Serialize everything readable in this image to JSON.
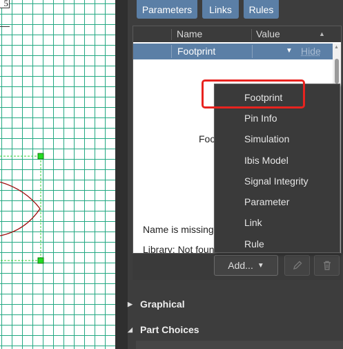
{
  "canvas": {
    "sheet_label": "5"
  },
  "panel": {
    "tabs": [
      "Parameters",
      "Links",
      "Rules"
    ],
    "table": {
      "columns": [
        "Name",
        "Value"
      ],
      "selected_row": {
        "name": "Footprint",
        "value_action": "Hide"
      },
      "message_partial": "Foo",
      "name_missing": "Name is missing",
      "library_partial": "Library: Not foun"
    },
    "add_label": "Add...",
    "sections": {
      "graphical": "Graphical",
      "part_choices": "Part Choices"
    }
  },
  "dropdown": {
    "items": [
      "Footprint",
      "Pin Info",
      "Simulation",
      "Ibis Model",
      "Signal Integrity",
      "Parameter",
      "Link",
      "Rule"
    ]
  },
  "colors": {
    "accent_blue": "#5b7fa6",
    "grid_green": "#22a882",
    "highlight_red": "#e8231f",
    "selection_handle": "#22dd22",
    "symbol_outline": "#a01010"
  }
}
